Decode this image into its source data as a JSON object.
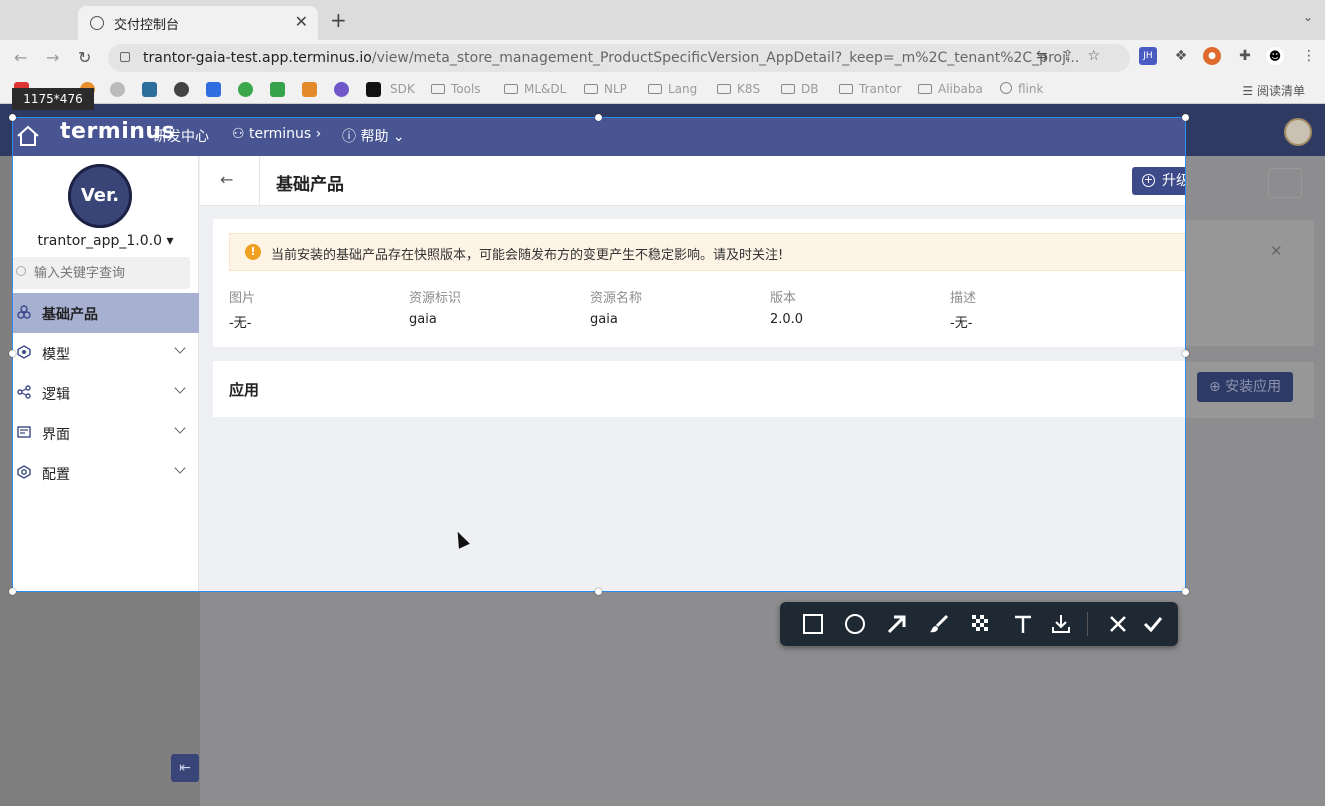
{
  "browser": {
    "tab_title": "交付控制台",
    "url_host": "trantor-gaia-test.app.terminus.io",
    "url_path": "/view/meta_store_management_ProductSpecificVersion_AppDetail?_keep=_m%2C_tenant%2C_proj...",
    "bookmarks": [
      "SDK",
      "Tools",
      "ML&DL",
      "NLP",
      "Lang",
      "K8S",
      "DB",
      "Trantor",
      "Alibaba",
      "flink"
    ],
    "reader_mode": "阅读清单",
    "extension_badge": "JH"
  },
  "capture": {
    "size_label": "1175*476"
  },
  "header": {
    "logo": "terminus",
    "nav": [
      "研发中心",
      "terminus",
      "帮助"
    ]
  },
  "sidebar": {
    "badge": "Ver.",
    "app_name": "trantor_app_1.0.0",
    "search_placeholder": "输入关键字查询",
    "items": [
      {
        "label": "基础产品",
        "icon": "product-icon"
      },
      {
        "label": "模型",
        "icon": "model-icon"
      },
      {
        "label": "逻辑",
        "icon": "logic-icon"
      },
      {
        "label": "界面",
        "icon": "ui-icon"
      },
      {
        "label": "配置",
        "icon": "config-icon"
      }
    ]
  },
  "page": {
    "back": "←",
    "title": "基础产品",
    "upgrade_button": "升级产品",
    "install_button": "安装应用",
    "alert": "当前安装的基础产品存在快照版本，可能会随发布方的变更产生不稳定影响。请及时关注!",
    "fields": [
      {
        "label": "图片",
        "value": "-无-"
      },
      {
        "label": "资源标识",
        "value": "gaia"
      },
      {
        "label": "资源名称",
        "value": "gaia"
      },
      {
        "label": "版本",
        "value": "2.0.0"
      },
      {
        "label": "描述",
        "value": "-无-"
      }
    ],
    "section_title": "应用"
  },
  "colors": {
    "header": "#485592",
    "active_menu": "#a7b0d1",
    "primary_button": "#3d4a8a",
    "selection_border": "#2f8cf0"
  }
}
